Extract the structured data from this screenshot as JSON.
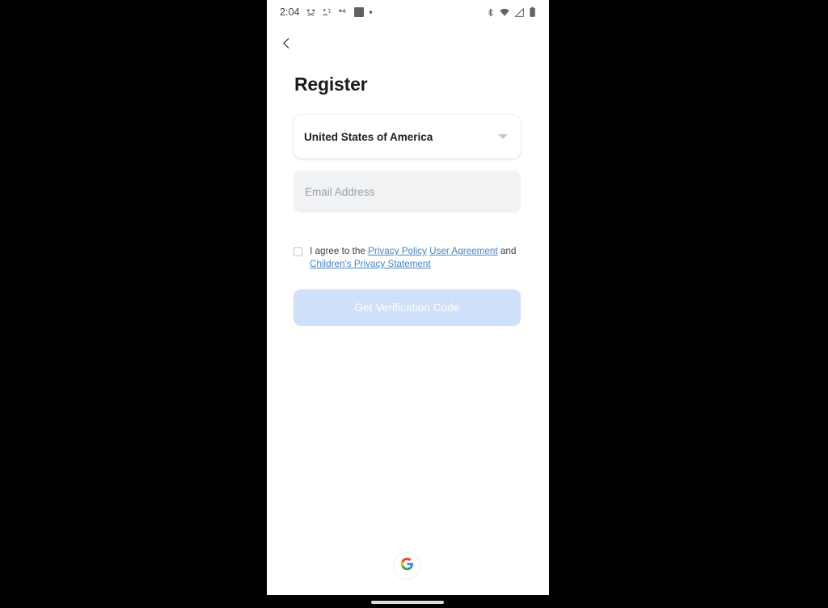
{
  "status_bar": {
    "time": "2:04",
    "left_icons": [
      "people-sync-icon",
      "bluetooth-device-icon",
      "mail-count-icon",
      "square-notification-icon",
      "dot-notification-icon"
    ],
    "right_icons": [
      "bluetooth-icon",
      "wifi-icon",
      "cellular-signal-icon",
      "battery-icon"
    ]
  },
  "nav": {
    "back_label": "Back",
    "back_icon": "chevron-left-icon"
  },
  "page": {
    "title": "Register"
  },
  "country_select": {
    "value": "United States of America",
    "caret_icon": "caret-down-icon"
  },
  "email_input": {
    "value": "",
    "placeholder": "Email Address"
  },
  "agreement": {
    "checked": false,
    "prefix": "I agree to the ",
    "link_privacy_policy": "Privacy Policy",
    "separator_space": " ",
    "link_user_agreement": "User Agreement",
    "conjunction": " and ",
    "link_childrens_privacy": "Children's Privacy Statement",
    "link_color": "#4285c5"
  },
  "verify_button": {
    "label": "Get Verification Code",
    "enabled": false,
    "background_color": "#cfe0fb",
    "text_color": "#ffffff"
  },
  "google_button": {
    "icon": "google-g-icon",
    "label": "Sign in with Google"
  },
  "system": {
    "gesture_bar": "home-indicator",
    "background_color": "#000000",
    "screen_color": "#ffffff"
  }
}
